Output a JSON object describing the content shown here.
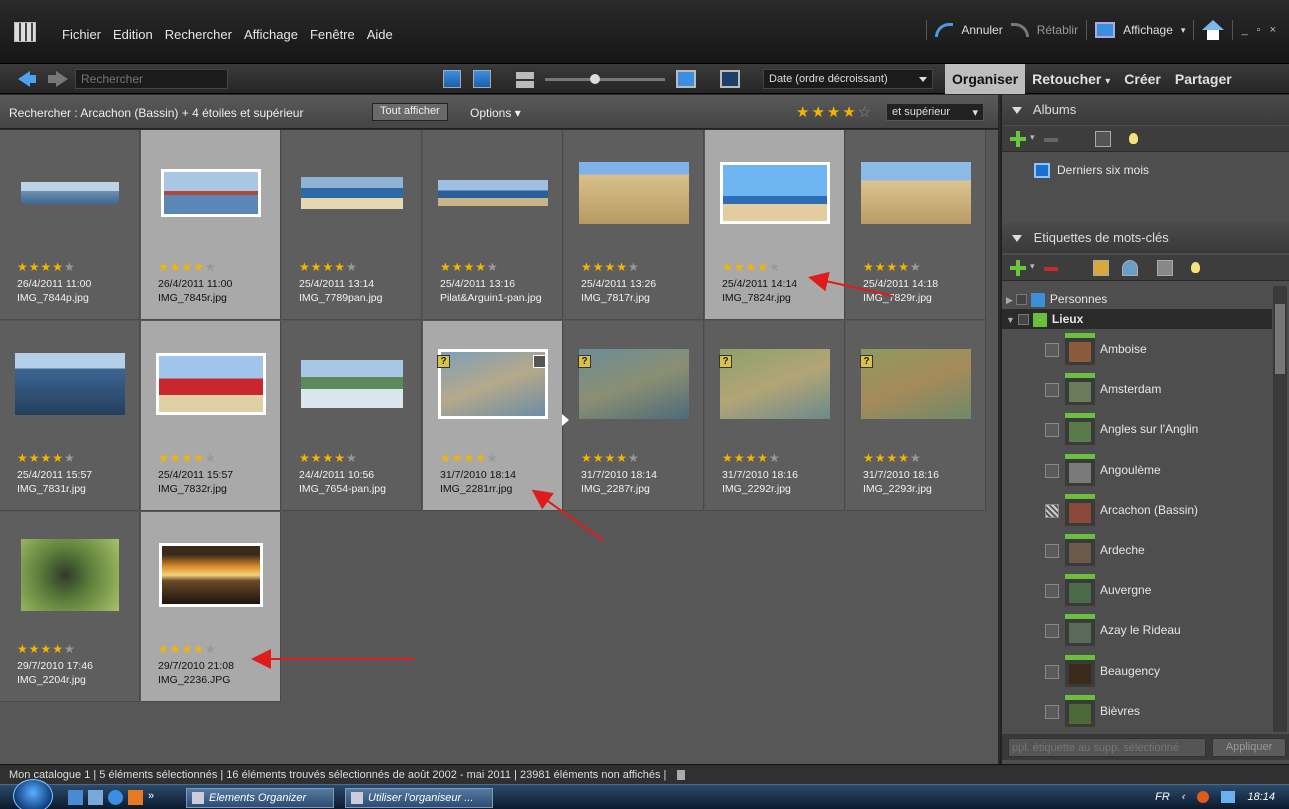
{
  "menubar": {
    "items": [
      "Fichier",
      "Edition",
      "Rechercher",
      "Affichage",
      "Fenêtre",
      "Aide"
    ],
    "undo": "Annuler",
    "redo": "Rétablir",
    "view": "Affichage",
    "window_controls": "_ ▫ ×"
  },
  "toolbar": {
    "search_placeholder": "Rechercher",
    "sort": "Date (ordre décroissant)",
    "tabs": [
      "Organiser",
      "Retoucher",
      "Créer",
      "Partager"
    ],
    "tab_retoucher_caret": "▾",
    "active_tab": "Organiser"
  },
  "filter": {
    "criteria": "Rechercher : Arcachon (Bassin)   +   4 étoiles et supérieur",
    "show_all": "Tout afficher",
    "options": "Options ▾",
    "rating": 4,
    "rating_max": 5,
    "scope": "et supérieur"
  },
  "photos": [
    {
      "date": "26/4/2011 11:00",
      "file": "IMG_7844p.jpg",
      "rating": 4,
      "selected": false
    },
    {
      "date": "26/4/2011 11:00",
      "file": "IMG_7845r.jpg",
      "rating": 4,
      "selected": true
    },
    {
      "date": "25/4/2011 13:14",
      "file": "IMG_7789pan.jpg",
      "rating": 4,
      "selected": false
    },
    {
      "date": "25/4/2011 13:16",
      "file": "Pilat&Arguin1-pan.jpg",
      "rating": 4,
      "selected": false
    },
    {
      "date": "25/4/2011 13:26",
      "file": "IMG_7817r.jpg",
      "rating": 4,
      "selected": false
    },
    {
      "date": "25/4/2011 14:14",
      "file": "IMG_7824r.jpg",
      "rating": 4,
      "selected": true
    },
    {
      "date": "25/4/2011 14:18",
      "file": "IMG_7829r.jpg",
      "rating": 4,
      "selected": false
    },
    {
      "date": "25/4/2011 15:57",
      "file": "IMG_7831r.jpg",
      "rating": 4,
      "selected": false
    },
    {
      "date": "25/4/2011 15:57",
      "file": "IMG_7832r.jpg",
      "rating": 4,
      "selected": true
    },
    {
      "date": "24/4/2011 10:56",
      "file": "IMG_7654-pan.jpg",
      "rating": 4,
      "selected": false
    },
    {
      "date": "31/7/2010 18:14",
      "file": "IMG_2281rr.jpg",
      "rating": 4,
      "selected": true
    },
    {
      "date": "31/7/2010 18:14",
      "file": "IMG_2287r.jpg",
      "rating": 4,
      "selected": false
    },
    {
      "date": "31/7/2010 18:16",
      "file": "IMG_2292r.jpg",
      "rating": 4,
      "selected": false
    },
    {
      "date": "31/7/2010 18:16",
      "file": "IMG_2293r.jpg",
      "rating": 4,
      "selected": false
    },
    {
      "date": "29/7/2010 17:46",
      "file": "IMG_2204r.jpg",
      "rating": 4,
      "selected": false
    },
    {
      "date": "29/7/2010 21:08",
      "file": "IMG_2236.JPG",
      "rating": 4,
      "selected": true
    }
  ],
  "badge_question": "?",
  "albums": {
    "title": "Albums",
    "items": [
      "Derniers six mois"
    ]
  },
  "tags": {
    "title": "Etiquettes de mots-clés",
    "categories": [
      "Personnes",
      "Lieux"
    ],
    "places": [
      "Amboise",
      "Amsterdam",
      "Angles sur l'Anglin",
      "Angoulème",
      "Arcachon (Bassin)",
      "Ardeche",
      "Auvergne",
      "Azay le Rideau",
      "Beaugency",
      "Bièvres"
    ],
    "apply_placeholder": "ppl. étiquette au supp. sélectionné",
    "apply_button": "Appliquer"
  },
  "status": "Mon catalogue 1  |  5 éléments sélectionnés  |  16 éléments trouvés sélectionnés de août 2002 - mai 2011  |  23981 éléments non affichés  |",
  "taskbar": {
    "buttons": [
      "Elements Organizer",
      "Utiliser l'organiseur ..."
    ],
    "lang": "FR",
    "time": "18:14",
    "quick_more": "»"
  },
  "colors": {
    "accent": "#4aa3ef",
    "star": "#f4b400",
    "annotation": "#e01b1b",
    "tag_green": "#6cbf3e"
  }
}
